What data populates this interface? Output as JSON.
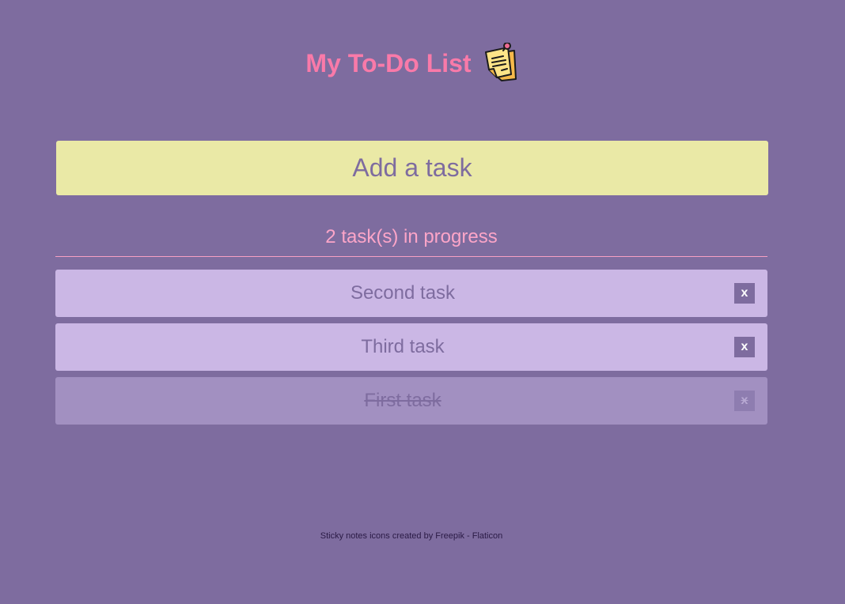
{
  "header": {
    "title": "My To-Do List",
    "icon": "sticky-note-icon"
  },
  "add_task": {
    "placeholder": "Add a task",
    "value": ""
  },
  "status": {
    "progress_text": "2 task(s) in progress"
  },
  "tasks": [
    {
      "label": "Second task",
      "completed": false,
      "delete_label": "x"
    },
    {
      "label": "Third task",
      "completed": false,
      "delete_label": "x"
    },
    {
      "label": "First task",
      "completed": true,
      "delete_label": "x"
    }
  ],
  "footer": {
    "prefix": "Sticky notes icons created by",
    "link_text": "Freepik - Flaticon"
  },
  "colors": {
    "background": "#7e6c9f",
    "title": "#f97aa9",
    "input_background": "#eae9a6",
    "task_background": "#cbb7e5",
    "task_done_background": "#a290c1"
  }
}
